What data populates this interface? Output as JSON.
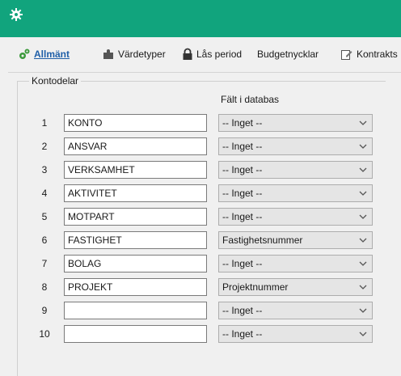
{
  "window": {
    "icon": "gear-icon"
  },
  "tabs": [
    {
      "label": "Allmänt",
      "icon": "gears-icon",
      "active": true
    },
    {
      "label": "Värdetyper",
      "icon": "puzzle-icon",
      "active": false
    },
    {
      "label": "Lås period",
      "icon": "lock-icon",
      "active": false
    },
    {
      "label": "Budgetnycklar",
      "icon": "",
      "active": false
    },
    {
      "label": "Kontrakts",
      "icon": "edit-icon",
      "active": false
    }
  ],
  "group": {
    "legend": "Kontodelar",
    "column_header": "Fält i databas",
    "rows": [
      {
        "num": "1",
        "name": "KONTO",
        "field": "-- Inget --"
      },
      {
        "num": "2",
        "name": "ANSVAR",
        "field": "-- Inget --"
      },
      {
        "num": "3",
        "name": "VERKSAMHET",
        "field": "-- Inget --"
      },
      {
        "num": "4",
        "name": "AKTIVITET",
        "field": "-- Inget --"
      },
      {
        "num": "5",
        "name": "MOTPART",
        "field": "-- Inget --"
      },
      {
        "num": "6",
        "name": "FASTIGHET",
        "field": "Fastighetsnummer"
      },
      {
        "num": "7",
        "name": "BOLAG",
        "field": "-- Inget --"
      },
      {
        "num": "8",
        "name": "PROJEKT",
        "field": "Projektnummer"
      },
      {
        "num": "9",
        "name": "",
        "field": "-- Inget --"
      },
      {
        "num": "10",
        "name": "",
        "field": "-- Inget --"
      }
    ]
  },
  "colors": {
    "titlebar": "#11a47d",
    "active_tab": "#1f5fa8"
  }
}
